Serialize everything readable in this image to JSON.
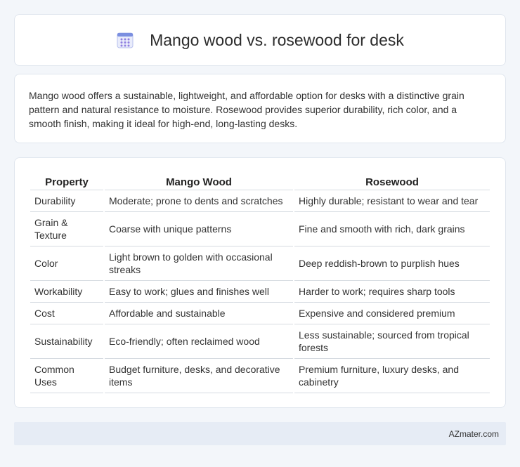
{
  "header": {
    "title": "Mango wood vs. rosewood for desk",
    "icon": "table-grid-icon",
    "icon_color": "#7b8fe0"
  },
  "summary": {
    "text": "Mango wood offers a sustainable, lightweight, and affordable option for desks with a distinctive grain pattern and natural resistance to moisture. Rosewood provides superior durability, rich color, and a smooth finish, making it ideal for high-end, long-lasting desks."
  },
  "table": {
    "headers": [
      "Property",
      "Mango Wood",
      "Rosewood"
    ],
    "rows": [
      [
        "Durability",
        "Moderate; prone to dents and scratches",
        "Highly durable; resistant to wear and tear"
      ],
      [
        "Grain & Texture",
        "Coarse with unique patterns",
        "Fine and smooth with rich, dark grains"
      ],
      [
        "Color",
        "Light brown to golden with occasional streaks",
        "Deep reddish-brown to purplish hues"
      ],
      [
        "Workability",
        "Easy to work; glues and finishes well",
        "Harder to work; requires sharp tools"
      ],
      [
        "Cost",
        "Affordable and sustainable",
        "Expensive and considered premium"
      ],
      [
        "Sustainability",
        "Eco-friendly; often reclaimed wood",
        "Less sustainable; sourced from tropical forests"
      ],
      [
        "Common Uses",
        "Budget furniture, desks, and decorative items",
        "Premium furniture, luxury desks, and cabinetry"
      ]
    ]
  },
  "footer": {
    "brand": "AZmater.com"
  }
}
